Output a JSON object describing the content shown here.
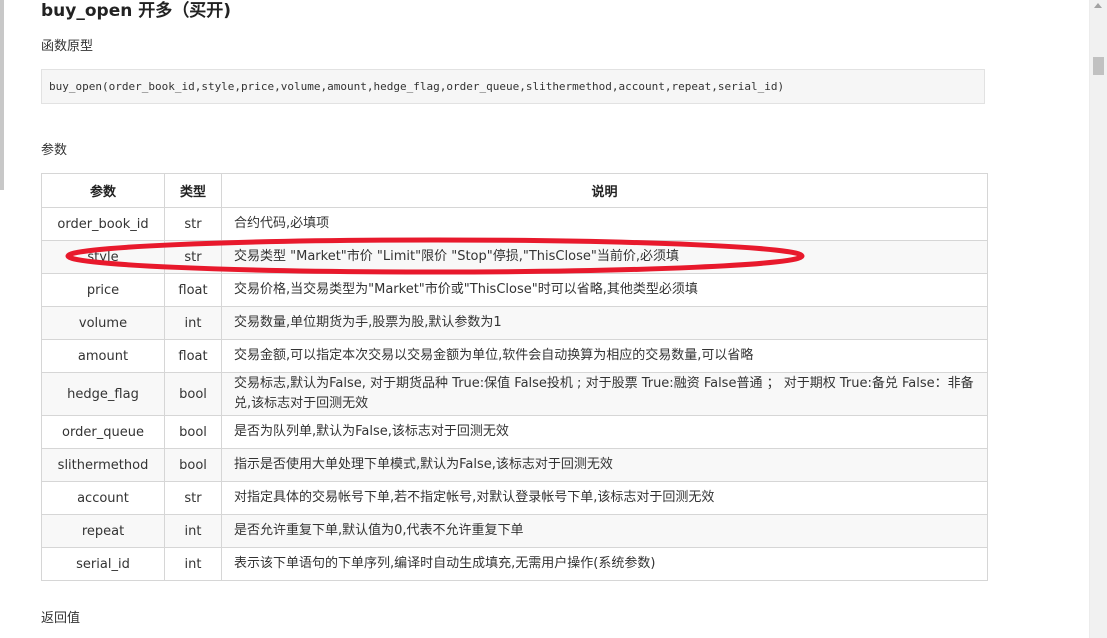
{
  "page": {
    "title": "buy_open 开多（买开)",
    "sections": {
      "prototype": "函数原型",
      "params": "参数",
      "returns": "返回值"
    },
    "code": "buy_open(order_book_id,style,price,volume,amount,hedge_flag,order_queue,slithermethod,account,repeat,serial_id)"
  },
  "table": {
    "headers": [
      "参数",
      "类型",
      "说明"
    ],
    "rows": [
      {
        "name": "order_book_id",
        "type": "str",
        "desc": "合约代码,必填项"
      },
      {
        "name": "style",
        "type": "str",
        "desc": "交易类型 \"Market\"市价 \"Limit\"限价 \"Stop\"停损,\"ThisClose\"当前价,必须填"
      },
      {
        "name": "price",
        "type": "float",
        "desc": "交易价格,当交易类型为\"Market\"市价或\"ThisClose\"时可以省略,其他类型必须填"
      },
      {
        "name": "volume",
        "type": "int",
        "desc": "交易数量,单位期货为手,股票为股,默认参数为1"
      },
      {
        "name": "amount",
        "type": "float",
        "desc": "交易金额,可以指定本次交易以交易金额为单位,软件会自动换算为相应的交易数量,可以省略"
      },
      {
        "name": "hedge_flag",
        "type": "bool",
        "desc": "交易标志,默认为False, 对于期货品种 True:保值 False投机 ; 对于股票 True:融资 False普通 ； 对于期权 True:备兑 False：非备兑,该标志对于回测无效"
      },
      {
        "name": "order_queue",
        "type": "bool",
        "desc": "是否为队列单,默认为False,该标志对于回测无效"
      },
      {
        "name": "slithermethod",
        "type": "bool",
        "desc": "指示是否使用大单处理下单模式,默认为False,该标志对于回测无效"
      },
      {
        "name": "account",
        "type": "str",
        "desc": "对指定具体的交易帐号下单,若不指定帐号,对默认登录帐号下单,该标志对于回测无效"
      },
      {
        "name": "repeat",
        "type": "int",
        "desc": "是否允许重复下单,默认值为0,代表不允许重复下单"
      },
      {
        "name": "serial_id",
        "type": "int",
        "desc": "表示该下单语句的下单序列,编译时自动生成填充,无需用户操作(系统参数)"
      }
    ]
  },
  "annotation": {
    "highlighted_row": "style",
    "color": "#e8192c"
  },
  "colors": {
    "text": "#333333",
    "border": "#d6d6d6",
    "code_bg": "#f6f6f6",
    "stripe_bg": "#f8f8f8"
  },
  "icons": {
    "scroll_up": "chevron-up-icon"
  }
}
